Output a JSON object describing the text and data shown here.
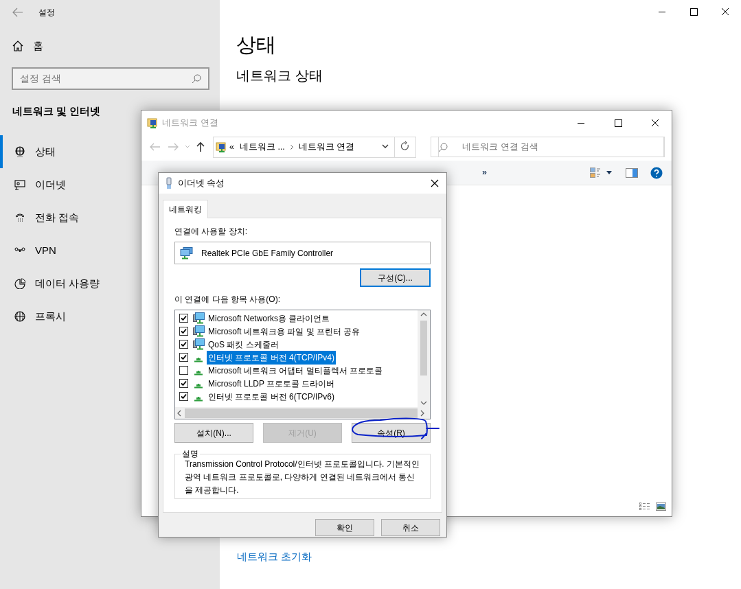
{
  "settings": {
    "title": "설정",
    "home": "홈",
    "search": {
      "placeholder": "설정 검색"
    },
    "section": "네트워크 및 인터넷",
    "nav": [
      {
        "label": "상태",
        "kind": "status",
        "selected": true
      },
      {
        "label": "이더넷",
        "kind": "ethernet",
        "selected": false
      },
      {
        "label": "전화 접속",
        "kind": "dialup",
        "selected": false
      },
      {
        "label": "VPN",
        "kind": "vpn",
        "selected": false
      },
      {
        "label": "데이터 사용량",
        "kind": "data",
        "selected": false
      },
      {
        "label": "프록시",
        "kind": "proxy",
        "selected": false
      }
    ],
    "heading": "상태",
    "subheading": "네트워크 상태",
    "reset_link": "네트워크 초기화"
  },
  "explorer": {
    "title": "네트워크 연결",
    "overflow": "«",
    "breadcrumb": [
      "네트워크 ...",
      "네트워크 연결"
    ],
    "search": {
      "placeholder": "네트워크 연결 검색"
    },
    "more": "»"
  },
  "dialog": {
    "title": "이더넷 속성",
    "tabs": [
      {
        "label": "네트워킹",
        "selected": true
      }
    ],
    "device_label": "연결에 사용할 장치:",
    "device": "Realtek PCIe GbE Family Controller",
    "configure_button": "구성(C)...",
    "items_label": "이 연결에 다음 항목 사용(O):",
    "items": [
      {
        "label": "Microsoft Networks용 클라이언트",
        "kind": "client",
        "checked": true,
        "selected": false
      },
      {
        "label": "Microsoft 네트워크용 파일 및 프린터 공유",
        "kind": "client",
        "checked": true,
        "selected": false
      },
      {
        "label": "QoS 패킷 스케줄러",
        "kind": "client",
        "checked": true,
        "selected": false
      },
      {
        "label": "인터넷 프로토콜 버전 4(TCP/IPv4)",
        "kind": "protocol",
        "checked": true,
        "selected": true
      },
      {
        "label": "Microsoft 네트워크 어댑터 멀티플렉서 프로토콜",
        "kind": "protocol",
        "checked": false,
        "selected": false
      },
      {
        "label": "Microsoft LLDP 프로토콜 드라이버",
        "kind": "protocol",
        "checked": true,
        "selected": false
      },
      {
        "label": "인터넷 프로토콜 버전 6(TCP/IPv6)",
        "kind": "protocol",
        "checked": true,
        "selected": false
      }
    ],
    "buttons": [
      {
        "label": "설치(N)...",
        "disabled": false
      },
      {
        "label": "제거(U)",
        "disabled": true
      },
      {
        "label": "속성(R)",
        "disabled": false
      }
    ],
    "description_title": "설명",
    "description": "Transmission Control Protocol/인터넷 프로토콜입니다. 기본적인 광역 네트워크 프로토콜로, 다양하게 연결된 네트워크에서 통신을 제공합니다.",
    "footer_buttons": [
      "확인",
      "취소"
    ]
  }
}
